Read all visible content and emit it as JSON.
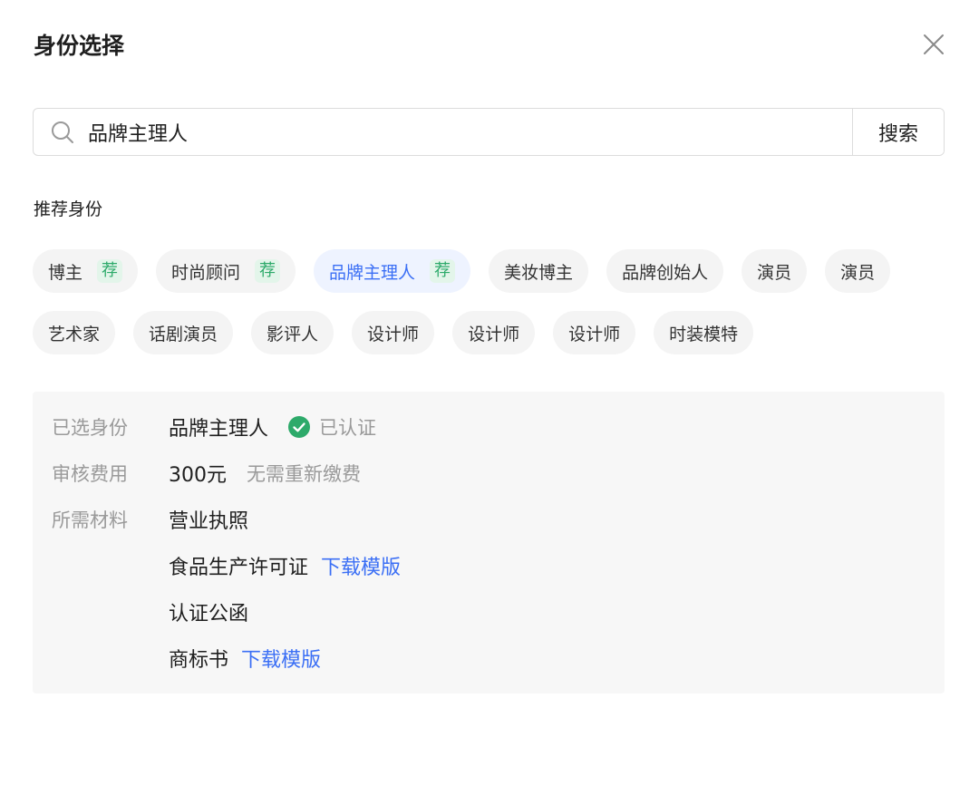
{
  "dialog": {
    "title": "身份选择"
  },
  "search": {
    "value": "品牌主理人",
    "button_label": "搜索"
  },
  "recommended": {
    "label": "推荐身份",
    "row1": [
      {
        "label": "博主",
        "tag": "荐"
      },
      {
        "label": "时尚顾问",
        "tag": "荐"
      },
      {
        "label": "品牌主理人",
        "tag": "荐",
        "selected": true
      },
      {
        "label": "美妆博主"
      },
      {
        "label": "品牌创始人"
      },
      {
        "label": "演员"
      },
      {
        "label": "演员"
      }
    ],
    "row2": [
      {
        "label": "艺术家"
      },
      {
        "label": "话剧演员"
      },
      {
        "label": "影评人"
      },
      {
        "label": "设计师"
      },
      {
        "label": "设计师"
      },
      {
        "label": "设计师"
      },
      {
        "label": "时装模特"
      }
    ]
  },
  "details": {
    "selected_label": "已选身份",
    "selected_value": "品牌主理人",
    "verified_text": "已认证",
    "fee_label": "审核费用",
    "fee_value": "300元",
    "fee_note": "无需重新缴费",
    "materials_label": "所需材料",
    "materials": [
      {
        "name": "营业执照",
        "link": ""
      },
      {
        "name": "食品生产许可证",
        "link": "下载模版"
      },
      {
        "name": "认证公函",
        "link": ""
      },
      {
        "name": "商标书",
        "link": "下载模版"
      }
    ]
  },
  "colors": {
    "accent": "#3b6ff5",
    "success": "#2daa6a",
    "recommend_bg": "#e3f5ea",
    "selected_bg": "#eef3ff"
  }
}
